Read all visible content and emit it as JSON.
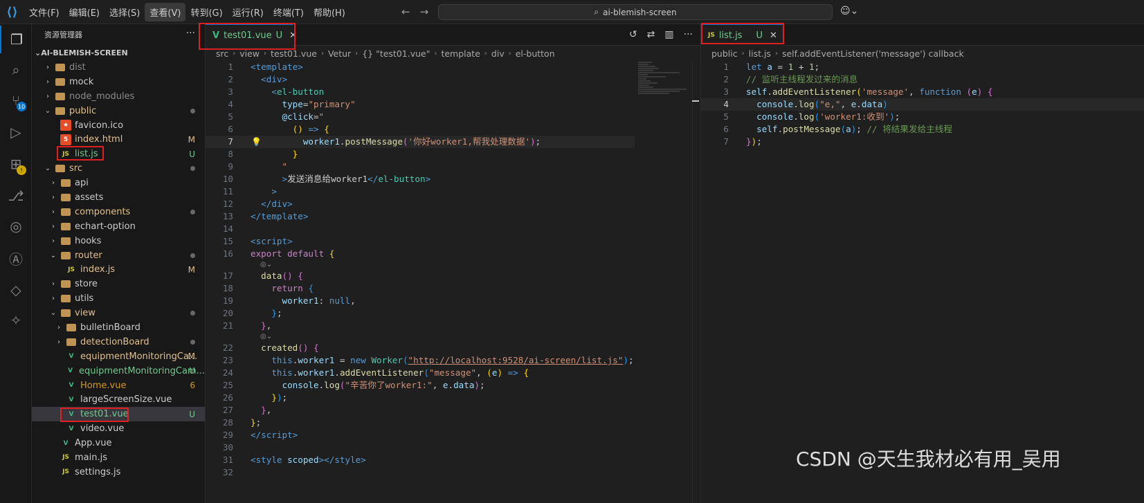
{
  "titlebar": {
    "menu": [
      "文件(F)",
      "编辑(E)",
      "选择(S)",
      "查看(V)",
      "转到(G)",
      "运行(R)",
      "终端(T)",
      "帮助(H)"
    ],
    "search": "ai-blemish-screen"
  },
  "activity": {
    "scm_badge": "10"
  },
  "sidebar": {
    "title": "资源管理器",
    "root": "AI-BLEMISH-SCREEN",
    "items": [
      {
        "label": "dist",
        "status": "",
        "color": "c-grey"
      },
      {
        "label": "mock",
        "status": "",
        "color": "c-white"
      },
      {
        "label": "node_modules",
        "status": "",
        "color": "c-grey"
      },
      {
        "label": "public",
        "status": "",
        "color": "c-yellow"
      },
      {
        "label": "favicon.ico",
        "status": "",
        "color": "c-white"
      },
      {
        "label": "index.html",
        "status": "M",
        "color": "c-yellow"
      },
      {
        "label": "list.js",
        "status": "U",
        "color": "c-green"
      },
      {
        "label": "src",
        "status": "",
        "color": "c-yellow"
      },
      {
        "label": "api",
        "status": "",
        "color": "c-white"
      },
      {
        "label": "assets",
        "status": "",
        "color": "c-white"
      },
      {
        "label": "components",
        "status": "",
        "color": "c-yellow"
      },
      {
        "label": "echart-option",
        "status": "",
        "color": "c-white"
      },
      {
        "label": "hooks",
        "status": "",
        "color": "c-white"
      },
      {
        "label": "router",
        "status": "",
        "color": "c-yellow"
      },
      {
        "label": "index.js",
        "status": "M",
        "color": "c-yellow"
      },
      {
        "label": "store",
        "status": "",
        "color": "c-white"
      },
      {
        "label": "utils",
        "status": "",
        "color": "c-white"
      },
      {
        "label": "view",
        "status": "",
        "color": "c-yellow"
      },
      {
        "label": "bulletinBoard",
        "status": "",
        "color": "c-white"
      },
      {
        "label": "detectionBoard",
        "status": "",
        "color": "c-yellow"
      },
      {
        "label": "equipmentMonitoringCa...",
        "status": "M",
        "color": "c-yellow"
      },
      {
        "label": "equipmentMonitoringCam...",
        "status": "U",
        "color": "c-green"
      },
      {
        "label": "Home.vue",
        "status": "6",
        "color": "c-orange"
      },
      {
        "label": "largeScreenSize.vue",
        "status": "",
        "color": "c-white"
      },
      {
        "label": "test01.vue",
        "status": "U",
        "color": "c-green"
      },
      {
        "label": "video.vue",
        "status": "",
        "color": "c-white"
      },
      {
        "label": "App.vue",
        "status": "",
        "color": "c-white"
      },
      {
        "label": "main.js",
        "status": "",
        "color": "c-white"
      },
      {
        "label": "settings.js",
        "status": "",
        "color": "c-white"
      }
    ]
  },
  "editor1": {
    "tab_label": "test01.vue",
    "tab_status": "U",
    "breadcrumb": [
      "src",
      "view",
      "test01.vue",
      "Vetur",
      "{} \"test01.vue\"",
      "template",
      "div",
      "el-button"
    ]
  },
  "editor2": {
    "tab_label": "list.js",
    "tab_status": "U",
    "breadcrumb": [
      "public",
      "list.js",
      "self.addEventListener('message') callback"
    ]
  },
  "code1_lines": [
    "1",
    "2",
    "3",
    "4",
    "5",
    "6",
    "7",
    "8",
    "9",
    "10",
    "11",
    "12",
    "13",
    "14",
    "15",
    "16",
    "17",
    "18",
    "19",
    "20",
    "21",
    "22",
    "23",
    "24",
    "25",
    "26",
    "27",
    "28",
    "29",
    "30",
    "31",
    "32"
  ],
  "code2_lines": [
    "1",
    "2",
    "3",
    "4",
    "5",
    "6",
    "7"
  ],
  "watermark": "CSDN @天生我材必有用_吴用"
}
